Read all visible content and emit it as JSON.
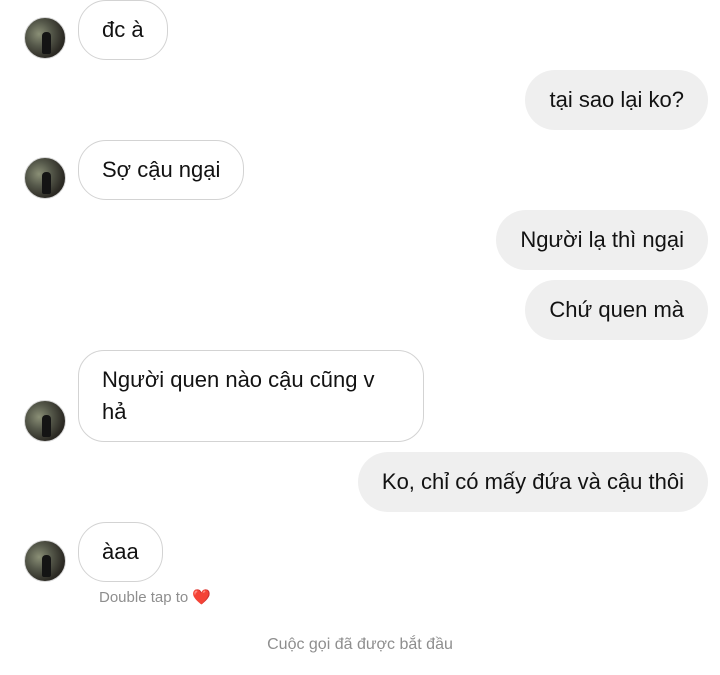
{
  "messages": [
    {
      "id": 1,
      "direction": "incoming",
      "text": "đc à"
    },
    {
      "id": 2,
      "direction": "outgoing",
      "text": "tại sao lại ko?"
    },
    {
      "id": 3,
      "direction": "incoming",
      "text": "Sợ cậu ngại"
    },
    {
      "id": 4,
      "direction": "outgoing",
      "text": "Người lạ thì ngại"
    },
    {
      "id": 5,
      "direction": "outgoing",
      "text": "Chứ quen mà"
    },
    {
      "id": 6,
      "direction": "incoming",
      "text": "Người quen nào cậu cũng v hả"
    },
    {
      "id": 7,
      "direction": "outgoing",
      "text": "Ko, chỉ có mấy đứa và cậu thôi"
    },
    {
      "id": 8,
      "direction": "incoming",
      "text": "àaa"
    }
  ],
  "double_tap_hint": "Double tap to",
  "double_tap_icon": "heart-icon",
  "system_notice": "Cuộc gọi đã được bắt đầu",
  "colors": {
    "outgoing_bubble": "#efefef",
    "incoming_border": "#d3d3d3",
    "hint_text": "#8e8e8e",
    "heart": "#ed4956"
  }
}
